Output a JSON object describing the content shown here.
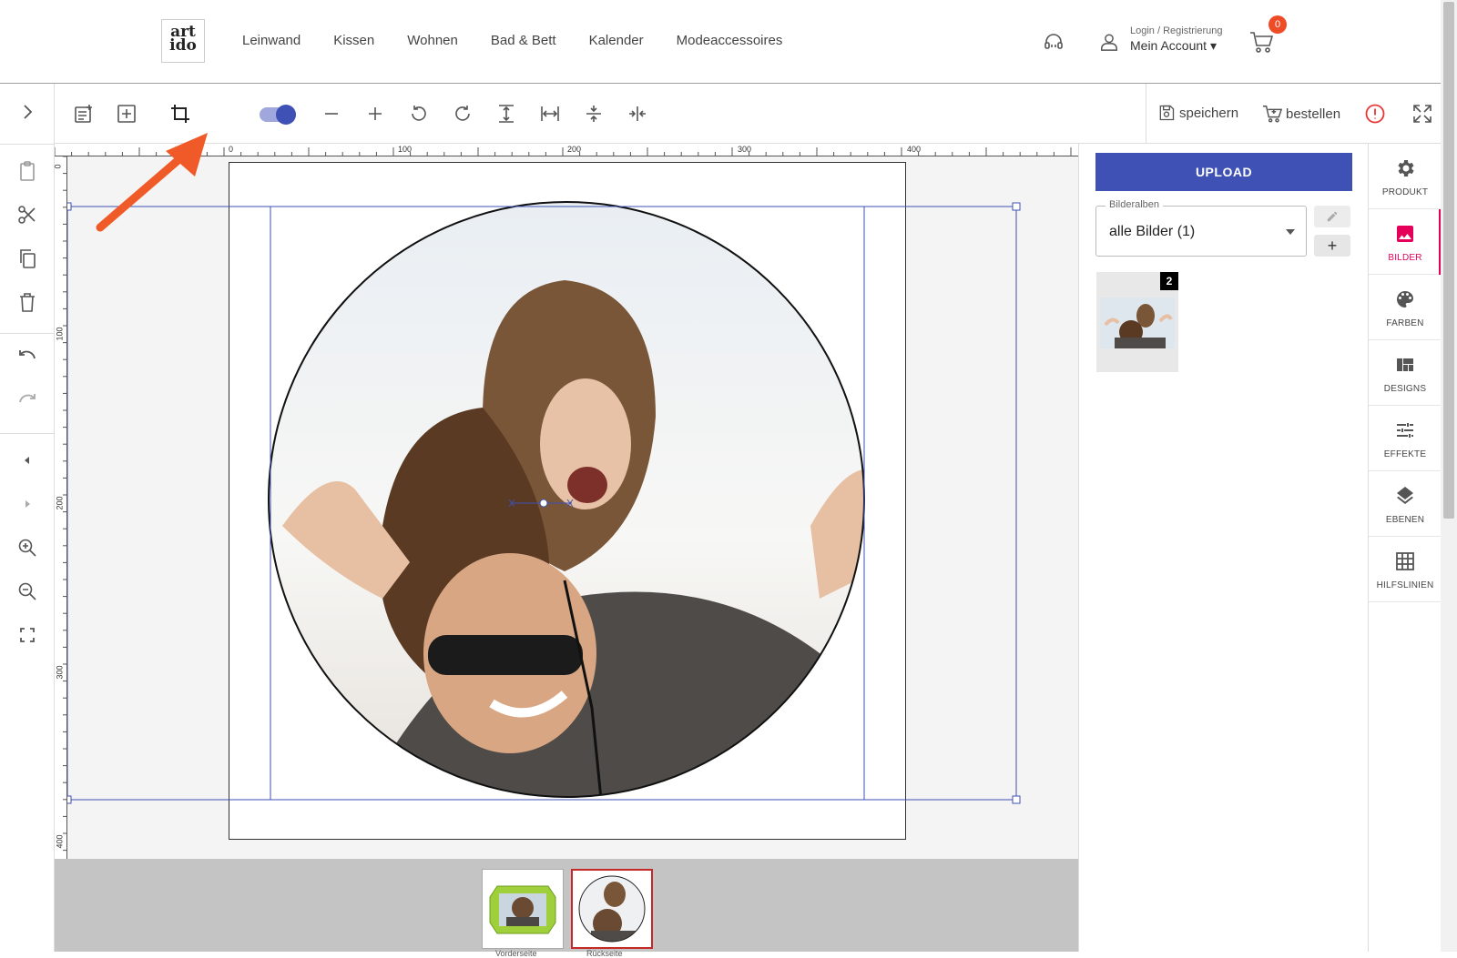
{
  "header": {
    "logo": {
      "line1": "art",
      "line2": "ido"
    },
    "nav": [
      "Leinwand",
      "Kissen",
      "Wohnen",
      "Bad & Bett",
      "Kalender",
      "Modeaccessoires"
    ],
    "account_small": "Login / Registrierung",
    "account_big": "Mein Account ▾",
    "cart_count": "0"
  },
  "toolbar": {
    "save_label": "speichern",
    "order_label": "bestellen",
    "crop_toggle_on": true
  },
  "ruler": {
    "h_labels": [
      "0",
      "100",
      "200",
      "300",
      "400"
    ],
    "v_labels": [
      "0",
      "100",
      "200",
      "300",
      "400"
    ]
  },
  "bottom": {
    "thumb_labels": [
      "Vorderseite",
      "Rückseite"
    ]
  },
  "panel": {
    "upload_label": "UPLOAD",
    "album_legend": "Bilderalben",
    "album_value": "alle Bilder (1)",
    "add_label": "+",
    "image_badge": "2"
  },
  "sidetabs": [
    {
      "label": "PRODUKT",
      "icon": "gear-icon"
    },
    {
      "label": "BILDER",
      "icon": "image-icon"
    },
    {
      "label": "FARBEN",
      "icon": "palette-icon"
    },
    {
      "label": "DESIGNS",
      "icon": "designs-icon"
    },
    {
      "label": "EFFEKTE",
      "icon": "sliders-icon"
    },
    {
      "label": "EBENEN",
      "icon": "layers-icon"
    },
    {
      "label": "HILFSLINIEN",
      "icon": "grid-icon"
    }
  ],
  "colors": {
    "accent": "#3f51b5",
    "active_tab": "#e5005a",
    "badge": "#ee4b27",
    "arrow": "#f05a28"
  }
}
